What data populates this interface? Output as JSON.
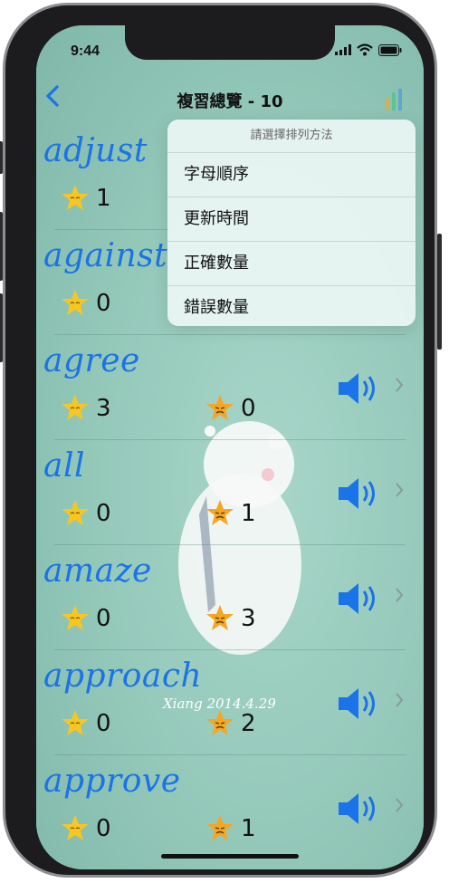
{
  "status": {
    "time": "9:44"
  },
  "nav": {
    "back_icon": "chevron-left-icon",
    "title": "複習總覽 - 10"
  },
  "sort_menu": {
    "title": "請選擇排列方法",
    "options": [
      "字母順序",
      "更新時間",
      "正確數量",
      "錯誤數量"
    ]
  },
  "rows": [
    {
      "word": "adjust",
      "correct": "1",
      "wrong": ""
    },
    {
      "word": "against",
      "correct": "0",
      "wrong": ""
    },
    {
      "word": "agree",
      "correct": "3",
      "wrong": "0"
    },
    {
      "word": "all",
      "correct": "0",
      "wrong": "1"
    },
    {
      "word": "amaze",
      "correct": "0",
      "wrong": "3"
    },
    {
      "word": "approach",
      "correct": "0",
      "wrong": "2"
    },
    {
      "word": "approve",
      "correct": "0",
      "wrong": "1"
    }
  ],
  "background_signature": "Xiang 2014.4.29",
  "colors": {
    "accent": "#1a73e8",
    "background": "#8fc7b9",
    "star": "#f7c623"
  }
}
